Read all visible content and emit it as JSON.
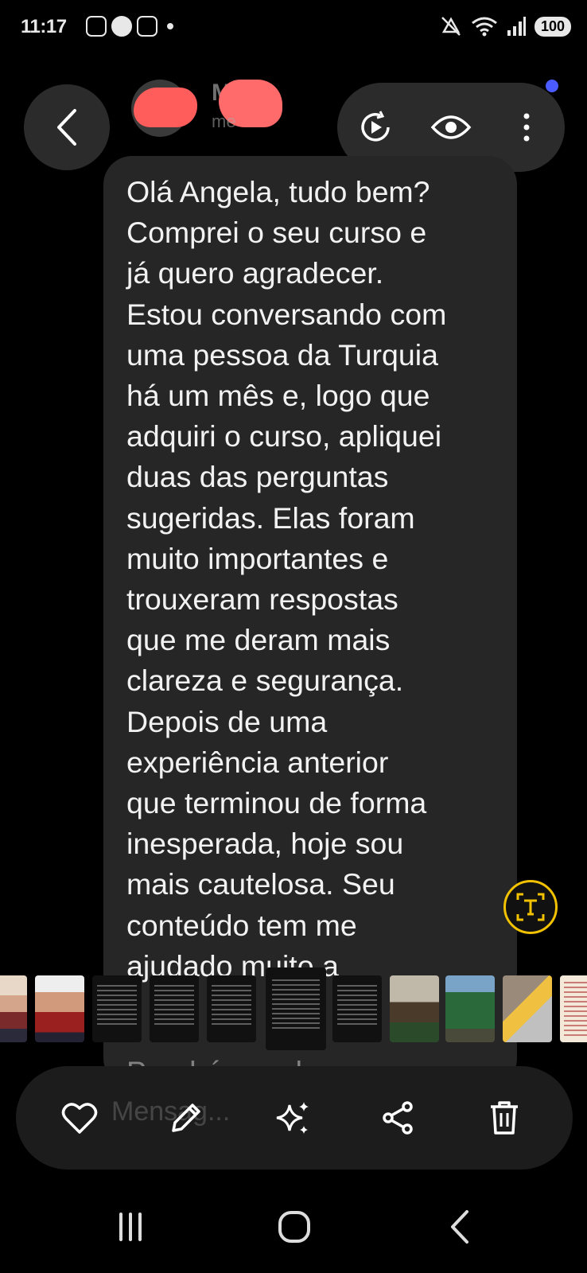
{
  "status_bar": {
    "time": "11:17",
    "battery": "100",
    "icons": [
      "screenshot-icon",
      "camera-icon",
      "instagram-icon",
      "mute-icon",
      "wifi-icon",
      "signal-icon"
    ]
  },
  "header": {
    "contact_name": "M",
    "contact_subtitle": "me",
    "actions": [
      "motion-photo-icon",
      "eye-icon",
      "more-icon"
    ]
  },
  "message": {
    "text": "Olá Angela, tudo bem?\nComprei o seu curso e\njá quero agradecer.\nEstou conversando com\numa pessoa da Turquia\nhá um mês e, logo que\nadquiri o curso, apliquei\nduas das perguntas\nsugeridas. Elas foram\nmuito importantes e\ntrouxeram respostas\nque me deram mais\nclareza e segurança.\nDepois de uma\nexperiência anterior\nque terminou de forma\ninesperada, hoje sou\nmais cautelosa. Seu\nconteúdo tem me\najudado muito a",
    "partial_tail": "Parabéns pelo seu"
  },
  "bottom_bar": {
    "ghost_input": "Mensag...",
    "actions": [
      "heart-icon",
      "pencil-icon",
      "sparkle-icon",
      "share-icon",
      "trash-icon"
    ]
  },
  "colors": {
    "background": "#000000",
    "bubble": "#262626",
    "pill": "#2b2b2b",
    "ocr_accent": "#f2c200"
  }
}
